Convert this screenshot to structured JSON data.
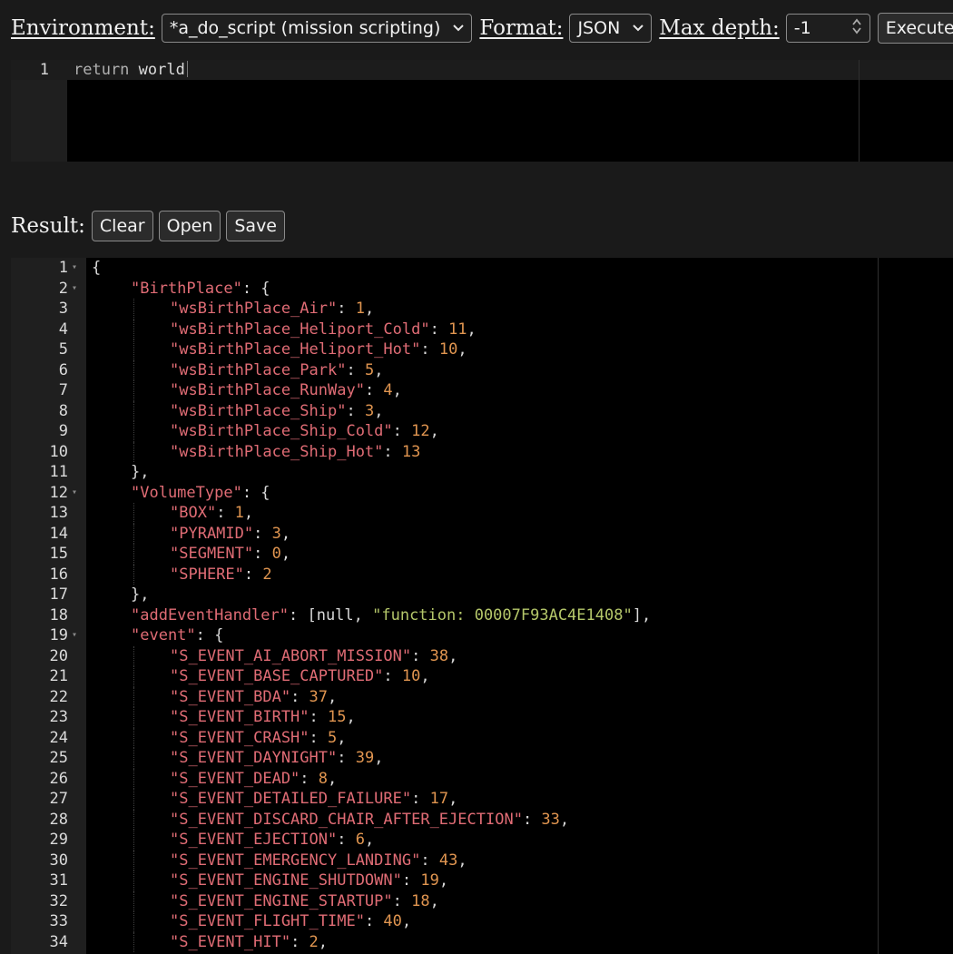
{
  "toolbar": {
    "environment_label": "Environment:",
    "environment_value": "*a_do_script (mission scripting)",
    "format_label": "Format:",
    "format_value": "JSON",
    "max_depth_label": "Max depth:",
    "max_depth_value": "-1",
    "execute_label": "Execute"
  },
  "editor": {
    "line_number": "1",
    "keyword": "return",
    "code": " world"
  },
  "result": {
    "label": "Result:",
    "clear_label": "Clear",
    "open_label": "Open",
    "save_label": "Save"
  },
  "output_lines": [
    {
      "n": "1",
      "fold": true,
      "depth": 0,
      "parts": [
        [
          "p",
          "{"
        ]
      ]
    },
    {
      "n": "2",
      "fold": true,
      "depth": 1,
      "parts": [
        [
          "k",
          "\"BirthPlace\""
        ],
        [
          "p",
          ": {"
        ]
      ]
    },
    {
      "n": "3",
      "depth": 2,
      "parts": [
        [
          "k",
          "\"wsBirthPlace_Air\""
        ],
        [
          "p",
          ": "
        ],
        [
          "v",
          "1"
        ],
        [
          "p",
          ","
        ]
      ]
    },
    {
      "n": "4",
      "depth": 2,
      "parts": [
        [
          "k",
          "\"wsBirthPlace_Heliport_Cold\""
        ],
        [
          "p",
          ": "
        ],
        [
          "v",
          "11"
        ],
        [
          "p",
          ","
        ]
      ]
    },
    {
      "n": "5",
      "depth": 2,
      "parts": [
        [
          "k",
          "\"wsBirthPlace_Heliport_Hot\""
        ],
        [
          "p",
          ": "
        ],
        [
          "v",
          "10"
        ],
        [
          "p",
          ","
        ]
      ]
    },
    {
      "n": "6",
      "depth": 2,
      "parts": [
        [
          "k",
          "\"wsBirthPlace_Park\""
        ],
        [
          "p",
          ": "
        ],
        [
          "v",
          "5"
        ],
        [
          "p",
          ","
        ]
      ]
    },
    {
      "n": "7",
      "depth": 2,
      "parts": [
        [
          "k",
          "\"wsBirthPlace_RunWay\""
        ],
        [
          "p",
          ": "
        ],
        [
          "v",
          "4"
        ],
        [
          "p",
          ","
        ]
      ]
    },
    {
      "n": "8",
      "depth": 2,
      "parts": [
        [
          "k",
          "\"wsBirthPlace_Ship\""
        ],
        [
          "p",
          ": "
        ],
        [
          "v",
          "3"
        ],
        [
          "p",
          ","
        ]
      ]
    },
    {
      "n": "9",
      "depth": 2,
      "parts": [
        [
          "k",
          "\"wsBirthPlace_Ship_Cold\""
        ],
        [
          "p",
          ": "
        ],
        [
          "v",
          "12"
        ],
        [
          "p",
          ","
        ]
      ]
    },
    {
      "n": "10",
      "depth": 2,
      "parts": [
        [
          "k",
          "\"wsBirthPlace_Ship_Hot\""
        ],
        [
          "p",
          ": "
        ],
        [
          "v",
          "13"
        ]
      ]
    },
    {
      "n": "11",
      "depth": 1,
      "parts": [
        [
          "p",
          "},"
        ]
      ]
    },
    {
      "n": "12",
      "fold": true,
      "depth": 1,
      "parts": [
        [
          "k",
          "\"VolumeType\""
        ],
        [
          "p",
          ": {"
        ]
      ]
    },
    {
      "n": "13",
      "depth": 2,
      "parts": [
        [
          "k",
          "\"BOX\""
        ],
        [
          "p",
          ": "
        ],
        [
          "v",
          "1"
        ],
        [
          "p",
          ","
        ]
      ]
    },
    {
      "n": "14",
      "depth": 2,
      "parts": [
        [
          "k",
          "\"PYRAMID\""
        ],
        [
          "p",
          ": "
        ],
        [
          "v",
          "3"
        ],
        [
          "p",
          ","
        ]
      ]
    },
    {
      "n": "15",
      "depth": 2,
      "parts": [
        [
          "k",
          "\"SEGMENT\""
        ],
        [
          "p",
          ": "
        ],
        [
          "v",
          "0"
        ],
        [
          "p",
          ","
        ]
      ]
    },
    {
      "n": "16",
      "depth": 2,
      "parts": [
        [
          "k",
          "\"SPHERE\""
        ],
        [
          "p",
          ": "
        ],
        [
          "v",
          "2"
        ]
      ]
    },
    {
      "n": "17",
      "depth": 1,
      "parts": [
        [
          "p",
          "},"
        ]
      ]
    },
    {
      "n": "18",
      "depth": 1,
      "parts": [
        [
          "k",
          "\"addEventHandler\""
        ],
        [
          "p",
          ": [null, "
        ],
        [
          "s",
          "\"function: 00007F93AC4E1408\""
        ],
        [
          "p",
          "],"
        ]
      ]
    },
    {
      "n": "19",
      "fold": true,
      "depth": 1,
      "parts": [
        [
          "k",
          "\"event\""
        ],
        [
          "p",
          ": {"
        ]
      ]
    },
    {
      "n": "20",
      "depth": 2,
      "parts": [
        [
          "k",
          "\"S_EVENT_AI_ABORT_MISSION\""
        ],
        [
          "p",
          ": "
        ],
        [
          "v",
          "38"
        ],
        [
          "p",
          ","
        ]
      ]
    },
    {
      "n": "21",
      "depth": 2,
      "parts": [
        [
          "k",
          "\"S_EVENT_BASE_CAPTURED\""
        ],
        [
          "p",
          ": "
        ],
        [
          "v",
          "10"
        ],
        [
          "p",
          ","
        ]
      ]
    },
    {
      "n": "22",
      "depth": 2,
      "parts": [
        [
          "k",
          "\"S_EVENT_BDA\""
        ],
        [
          "p",
          ": "
        ],
        [
          "v",
          "37"
        ],
        [
          "p",
          ","
        ]
      ]
    },
    {
      "n": "23",
      "depth": 2,
      "parts": [
        [
          "k",
          "\"S_EVENT_BIRTH\""
        ],
        [
          "p",
          ": "
        ],
        [
          "v",
          "15"
        ],
        [
          "p",
          ","
        ]
      ]
    },
    {
      "n": "24",
      "depth": 2,
      "parts": [
        [
          "k",
          "\"S_EVENT_CRASH\""
        ],
        [
          "p",
          ": "
        ],
        [
          "v",
          "5"
        ],
        [
          "p",
          ","
        ]
      ]
    },
    {
      "n": "25",
      "depth": 2,
      "parts": [
        [
          "k",
          "\"S_EVENT_DAYNIGHT\""
        ],
        [
          "p",
          ": "
        ],
        [
          "v",
          "39"
        ],
        [
          "p",
          ","
        ]
      ]
    },
    {
      "n": "26",
      "depth": 2,
      "parts": [
        [
          "k",
          "\"S_EVENT_DEAD\""
        ],
        [
          "p",
          ": "
        ],
        [
          "v",
          "8"
        ],
        [
          "p",
          ","
        ]
      ]
    },
    {
      "n": "27",
      "depth": 2,
      "parts": [
        [
          "k",
          "\"S_EVENT_DETAILED_FAILURE\""
        ],
        [
          "p",
          ": "
        ],
        [
          "v",
          "17"
        ],
        [
          "p",
          ","
        ]
      ]
    },
    {
      "n": "28",
      "depth": 2,
      "parts": [
        [
          "k",
          "\"S_EVENT_DISCARD_CHAIR_AFTER_EJECTION\""
        ],
        [
          "p",
          ": "
        ],
        [
          "v",
          "33"
        ],
        [
          "p",
          ","
        ]
      ]
    },
    {
      "n": "29",
      "depth": 2,
      "parts": [
        [
          "k",
          "\"S_EVENT_EJECTION\""
        ],
        [
          "p",
          ": "
        ],
        [
          "v",
          "6"
        ],
        [
          "p",
          ","
        ]
      ]
    },
    {
      "n": "30",
      "depth": 2,
      "parts": [
        [
          "k",
          "\"S_EVENT_EMERGENCY_LANDING\""
        ],
        [
          "p",
          ": "
        ],
        [
          "v",
          "43"
        ],
        [
          "p",
          ","
        ]
      ]
    },
    {
      "n": "31",
      "depth": 2,
      "parts": [
        [
          "k",
          "\"S_EVENT_ENGINE_SHUTDOWN\""
        ],
        [
          "p",
          ": "
        ],
        [
          "v",
          "19"
        ],
        [
          "p",
          ","
        ]
      ]
    },
    {
      "n": "32",
      "depth": 2,
      "parts": [
        [
          "k",
          "\"S_EVENT_ENGINE_STARTUP\""
        ],
        [
          "p",
          ": "
        ],
        [
          "v",
          "18"
        ],
        [
          "p",
          ","
        ]
      ]
    },
    {
      "n": "33",
      "depth": 2,
      "parts": [
        [
          "k",
          "\"S_EVENT_FLIGHT_TIME\""
        ],
        [
          "p",
          ": "
        ],
        [
          "v",
          "40"
        ],
        [
          "p",
          ","
        ]
      ]
    },
    {
      "n": "34",
      "depth": 2,
      "parts": [
        [
          "k",
          "\"S_EVENT_HIT\""
        ],
        [
          "p",
          ": "
        ],
        [
          "v",
          "2"
        ],
        [
          "p",
          ","
        ]
      ]
    }
  ]
}
